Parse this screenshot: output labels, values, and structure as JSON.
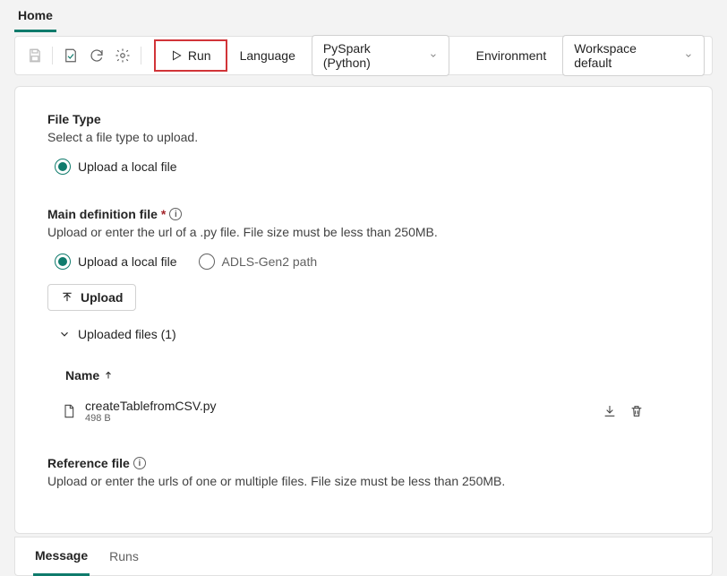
{
  "tabs": {
    "home": "Home"
  },
  "toolbar": {
    "run_label": "Run",
    "language_label": "Language",
    "language_value": "PySpark (Python)",
    "environment_label": "Environment",
    "environment_value": "Workspace default"
  },
  "filetype": {
    "title": "File Type",
    "desc": "Select a file type to upload.",
    "opt_local": "Upload a local file"
  },
  "maindef": {
    "title": "Main definition file",
    "desc": "Upload or enter the url of a .py file. File size must be less than 250MB.",
    "opt_local": "Upload a local file",
    "opt_adls": "ADLS-Gen2 path",
    "upload_btn": "Upload",
    "uploaded_label": "Uploaded files (1)",
    "col_name": "Name",
    "files": [
      {
        "name": "createTablefromCSV.py",
        "size": "498 B"
      }
    ]
  },
  "reffile": {
    "title": "Reference file",
    "desc": "Upload or enter the urls of one or multiple files. File size must be less than 250MB."
  },
  "bottom_tabs": {
    "message": "Message",
    "runs": "Runs"
  }
}
